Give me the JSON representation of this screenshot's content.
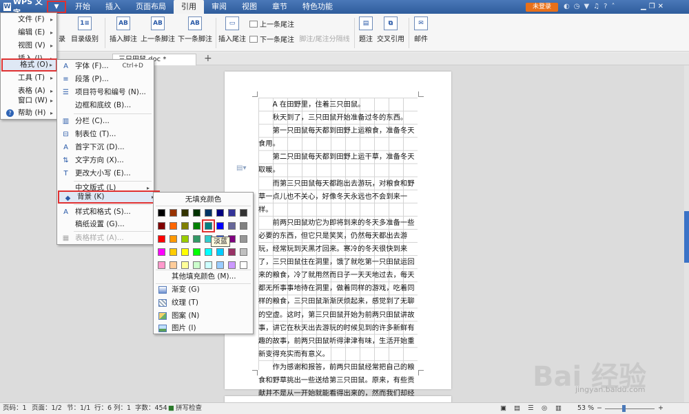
{
  "app": {
    "title": "WPS 文字",
    "menu_arrow": "▼"
  },
  "tabs": [
    "开始",
    "插入",
    "页面布局",
    "引用",
    "审阅",
    "视图",
    "章节",
    "特色功能"
  ],
  "active_tab": "引用",
  "login_label": "未登录",
  "help_label": "?",
  "ribbon": {
    "b_mulu": "录",
    "b_level": "目录级别",
    "b_insert_footnote": "插入脚注",
    "b_prev_footnote": "上一条脚注",
    "b_next_footnote": "下一条脚注",
    "b_insert_endnote": "插入尾注",
    "b_prev_endnote": "上一条尾注",
    "b_next_endnote": "下一条尾注",
    "b_separator": "脚注/尾注分隔线",
    "b_caption": "题注",
    "b_crossref": "交叉引用",
    "b_mail": "邮件",
    "ico_ab1": "AB",
    "ico_ab2": "AB",
    "ico_ab3": "AB"
  },
  "doc_tab": {
    "name": "三只田鼠.doc *"
  },
  "main_menu": {
    "items": [
      {
        "label": "文件 (F)"
      },
      {
        "label": "编辑 (E)"
      },
      {
        "label": "视图 (V)"
      },
      {
        "label": "插入 (I)"
      },
      {
        "label": "格式 (O)"
      },
      {
        "label": "工具 (T)"
      },
      {
        "label": "表格 (A)"
      },
      {
        "label": "窗口 (W)"
      },
      {
        "label": "帮助 (H)"
      }
    ]
  },
  "format_menu": {
    "items": [
      {
        "label": "字体 (F)...",
        "shortcut": "Ctrl+D",
        "icon": "A"
      },
      {
        "label": "段落 (P)...",
        "icon": "≡"
      },
      {
        "label": "项目符号和编号 (N)...",
        "icon": "☰"
      },
      {
        "label": "边框和底纹 (B)..."
      },
      {
        "label": "分栏 (C)...",
        "icon": "▥"
      },
      {
        "label": "制表位 (T)...",
        "icon": "⊟"
      },
      {
        "label": "首字下沉 (D)...",
        "icon": "A"
      },
      {
        "label": "文字方向 (X)...",
        "icon": "⇅"
      },
      {
        "label": "更改大小写 (E)...",
        "icon": "T"
      },
      {
        "label": "中文版式 (L)"
      },
      {
        "label": "背景 (K)",
        "icon": "◆"
      },
      {
        "label": "样式和格式 (S)...",
        "icon": "A"
      },
      {
        "label": "稿纸设置 (G)..."
      },
      {
        "label": "表格样式 (A)...",
        "icon": "▦"
      }
    ]
  },
  "background_menu": {
    "no_fill": "无填充颜色",
    "swatches": [
      "#000000",
      "#993300",
      "#333300",
      "#003300",
      "#003366",
      "#000080",
      "#333399",
      "#333333",
      "#800000",
      "#FF6600",
      "#808000",
      "#008000",
      "#008080",
      "#0000FF",
      "#666699",
      "#808080",
      "#FF0000",
      "#FF9900",
      "#99CC00",
      "#339966",
      "#33CCCC",
      "#3366FF",
      "#800080",
      "#969696",
      "#FF00FF",
      "#FFCC00",
      "#FFFF00",
      "#00FF00",
      "#00FFFF",
      "#00CCFF",
      "#993366",
      "#C0C0C0",
      "#FF99CC",
      "#FFCC99",
      "#FFFF99",
      "#CCFFCC",
      "#CCFFFF",
      "#99CCFF",
      "#CC99FF",
      "#FFFFFF"
    ],
    "tooltip": "淡蓝",
    "more_colors": "其他填充颜色 (M)...",
    "fill_items": [
      {
        "label": "渐变 (G)"
      },
      {
        "label": "纹理 (T)"
      },
      {
        "label": "图案 (N)"
      },
      {
        "label": "图片 (I)"
      }
    ]
  },
  "document": {
    "paragraphs": [
      "A 在田野里，住着三只田鼠。",
      "秋天到了，三只田鼠开始准备过冬的东西。",
      "第一只田鼠每天都到田野上运粮食，准备冬天食用。",
      "第二只田鼠每天都到田野上运干草，准备冬天取暖。",
      "而第三只田鼠每天都跑出去游玩，对粮食和野草一点儿也不关心，好像冬天永远也不会到来一样。",
      "前两只田鼠劝它为即将到来的冬天多准备一些必要的东西，但它只是笑笑，仍然每天都出去游玩，经常玩到天黑才回来。寒冷的冬天很快到来了，三只田鼠住在洞里，饿了就吃第一只田鼠运回来的粮食，冷了就用然而日子一天天地过去，每天都无所事事地待在洞里，做着同样的游戏，吃着同样的粮食，三只田鼠渐渐厌烦起来，感觉到了无聊的空虚。这时，第三只田鼠开始为前两只田鼠讲故事，讲它在秋天出去游玩的时候见到的许多新鲜有趣的故事，前两只田鼠听得津津有味，生活开始重新变得充实而有意义。",
      "作为感谢和报答，前两只田鼠经常把自己的粮食和野草挑出一些送给第三只田鼠。原来，有些贡献并不是从一开始就能看得出来的，然而我们却经常因为暂时看不到它的“用处”就舍弃了它。撕掉一篇日历很"
    ]
  },
  "status": {
    "page_code": "页码：1",
    "page": "页面：1/2",
    "section": "节：1/1",
    "row": "行：6",
    "col": "列：1",
    "chars": "字数：454",
    "spell": "拼写检查",
    "zoom": "53 %"
  },
  "watermark": {
    "main": "Bai 经验",
    "sub": "jingyan.baidu.com"
  }
}
